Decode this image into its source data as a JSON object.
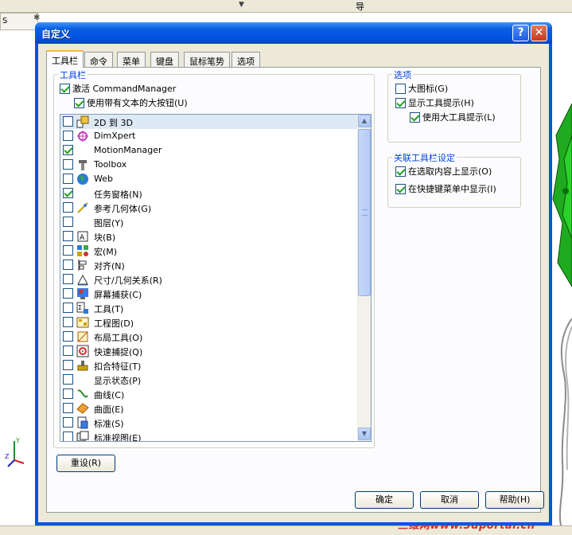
{
  "background": {
    "tab_fragment": "S",
    "header_fragment": "导",
    "watermark": "三维网www.3dportal.cn"
  },
  "dialog": {
    "title": "自定义",
    "help_glyph": "?",
    "close_glyph": "✕",
    "tabs": [
      {
        "label": "工具栏",
        "active": true
      },
      {
        "label": "命令",
        "active": false
      },
      {
        "label": "菜单",
        "active": false
      },
      {
        "label": "键盘",
        "active": false
      },
      {
        "label": "鼠标笔势",
        "active": false
      },
      {
        "label": "选项",
        "active": false
      }
    ],
    "toolbars_group": {
      "label": "工具栏",
      "activate_cm": {
        "label": "激活 CommandManager",
        "checked": true
      },
      "large_buttons": {
        "label": "使用带有文本的大按钮(U)",
        "checked": true
      }
    },
    "list": [
      {
        "label": "2D 到 3D",
        "checked": false,
        "icon": "2d-to-3d-icon",
        "selected": true
      },
      {
        "label": "DimXpert",
        "checked": false,
        "icon": "dimxpert-icon"
      },
      {
        "label": "MotionManager",
        "checked": true,
        "icon": "none"
      },
      {
        "label": "Toolbox",
        "checked": false,
        "icon": "toolbox-icon"
      },
      {
        "label": "Web",
        "checked": false,
        "icon": "globe-icon"
      },
      {
        "label": "任务窗格(N)",
        "checked": true,
        "icon": "none"
      },
      {
        "label": "参考几何体(G)",
        "checked": false,
        "icon": "reference-geometry-icon"
      },
      {
        "label": "图层(Y)",
        "checked": false,
        "icon": "none"
      },
      {
        "label": "块(B)",
        "checked": false,
        "icon": "block-icon"
      },
      {
        "label": "宏(M)",
        "checked": false,
        "icon": "macro-icon"
      },
      {
        "label": "对齐(N)",
        "checked": false,
        "icon": "align-icon"
      },
      {
        "label": "尺寸/几何关系(R)",
        "checked": false,
        "icon": "dimension-icon"
      },
      {
        "label": "屏幕捕获(C)",
        "checked": false,
        "icon": "screen-capture-icon"
      },
      {
        "label": "工具(T)",
        "checked": false,
        "icon": "tools-icon"
      },
      {
        "label": "工程图(D)",
        "checked": false,
        "icon": "drawing-icon"
      },
      {
        "label": "布局工具(O)",
        "checked": false,
        "icon": "layout-icon"
      },
      {
        "label": "快速捕捉(Q)",
        "checked": false,
        "icon": "quick-snap-icon"
      },
      {
        "label": "扣合特征(T)",
        "checked": false,
        "icon": "fastening-feature-icon"
      },
      {
        "label": "显示状态(P)",
        "checked": false,
        "icon": "none"
      },
      {
        "label": "曲线(C)",
        "checked": false,
        "icon": "curve-icon"
      },
      {
        "label": "曲面(E)",
        "checked": false,
        "icon": "surface-icon"
      },
      {
        "label": "标准(S)",
        "checked": false,
        "icon": "standard-icon"
      },
      {
        "label": "标准视图(E)",
        "checked": false,
        "icon": "standard-views-icon"
      }
    ],
    "options_group": {
      "label": "选项",
      "items": [
        {
          "label": "大图标(G)",
          "checked": false
        },
        {
          "label": "显示工具提示(H)",
          "checked": true
        },
        {
          "label": "使用大工具提示(L)",
          "checked": true
        }
      ]
    },
    "context_group": {
      "label": "关联工具栏设定",
      "items": [
        {
          "label": "在选取内容上显示(O)",
          "checked": true
        },
        {
          "label": "在快捷键菜单中显示(I)",
          "checked": true
        }
      ]
    },
    "reset_label": "重设(R)",
    "ok_label": "确定",
    "cancel_label": "取消",
    "help_label": "帮助(H)"
  }
}
